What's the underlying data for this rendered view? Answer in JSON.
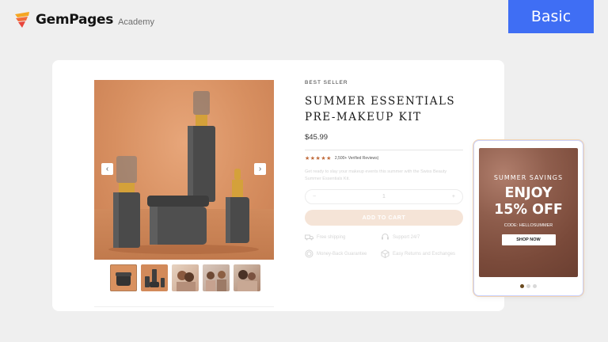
{
  "brand": {
    "name": "GemPages",
    "sub": "Academy"
  },
  "badge": {
    "label": "Basic"
  },
  "gallery": {
    "prev": "‹",
    "next": "›",
    "thumbnail_count": 5,
    "active_thumbnail": 1
  },
  "product": {
    "eyebrow": "BEST SELLER",
    "title": "SUMMER ESSENTIALS PRE-MAKEUP KIT",
    "price": "$45.99",
    "stars": "★★★★★",
    "reviews": "2,500+ Verified Reviews)",
    "description": "Get ready to slay your makeup events this summer with the Swiss Beauty Summer Essentials Kit.",
    "qty_minus": "−",
    "qty_value": "1",
    "qty_plus": "+",
    "add_to_cart": "ADD TO CART",
    "features": [
      {
        "icon": "truck-icon",
        "label": "Free shipping"
      },
      {
        "icon": "headset-icon",
        "label": "Support 24/7"
      },
      {
        "icon": "money-back-icon",
        "label": "Money-Back Guarantee"
      },
      {
        "icon": "box-icon",
        "label": "Easy Returns and Exchanges"
      }
    ]
  },
  "promo": {
    "title": "SUMMER SAVINGS",
    "line1": "ENJOY",
    "line2": "15% OFF",
    "code": "CODE: HELLOSUMMER",
    "button": "SHOP NOW",
    "slide_count": 3,
    "active_slide": 1
  },
  "colors": {
    "badge": "#3f6ef4",
    "accent": "#c06a3a",
    "button_disabled": "#f5e4d7"
  }
}
